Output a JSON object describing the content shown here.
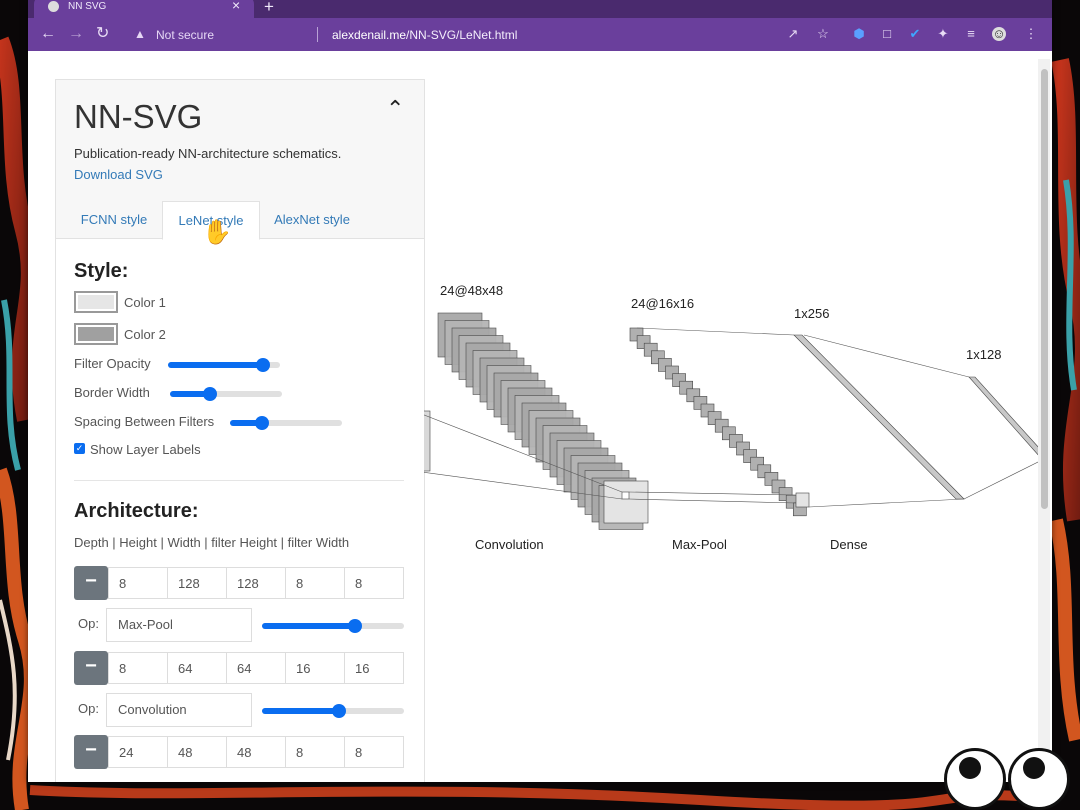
{
  "browser": {
    "tab_title": "NN SVG",
    "tab_close": "×",
    "new_tab": "+",
    "security_label": "Not secure",
    "url_domain": "alexdenail.me",
    "url_path": "/NN-SVG/LeNet.html"
  },
  "panel": {
    "title": "NN-SVG",
    "tagline": "Publication-ready NN-architecture schematics.",
    "download_link": "Download SVG",
    "tabs": [
      {
        "label": "FCNN style"
      },
      {
        "label": "LeNet style",
        "active": true
      },
      {
        "label": "AlexNet style"
      }
    ],
    "style": {
      "heading": "Style:",
      "color1_label": "Color 1",
      "color1_value": "#e6e6e6",
      "color2_label": "Color 2",
      "color2_value": "#a0a0a0",
      "filter_opacity_label": "Filter Opacity",
      "filter_opacity_value": 0.85,
      "border_width_label": "Border Width",
      "border_width_value": 0.3,
      "spacing_label": "Spacing Between Filters",
      "spacing_value": 0.25,
      "show_labels_label": "Show Layer Labels",
      "show_labels_checked": true
    },
    "architecture": {
      "heading": "Architecture:",
      "columns_caption": "Depth | Height | Width | filter Height | filter Width",
      "layers": [
        {
          "values": [
            "8",
            "128",
            "128",
            "8",
            "8"
          ],
          "op": "Max-Pool",
          "op_slider": 0.75
        },
        {
          "values": [
            "8",
            "64",
            "64",
            "16",
            "16"
          ],
          "op": "Convolution",
          "op_slider": 0.5
        },
        {
          "values": [
            "24",
            "48",
            "48",
            "8",
            "8"
          ]
        }
      ],
      "op_label": "Op:"
    }
  },
  "diagram": {
    "layer_labels": [
      "24@48x48",
      "24@16x16",
      "1x256",
      "1x128"
    ],
    "op_labels": [
      "Convolution",
      "Max-Pool",
      "Dense"
    ]
  },
  "colors": {
    "browser_frame": "#6a3f9c",
    "accent": "#0a6df0",
    "link": "#337ab7"
  }
}
